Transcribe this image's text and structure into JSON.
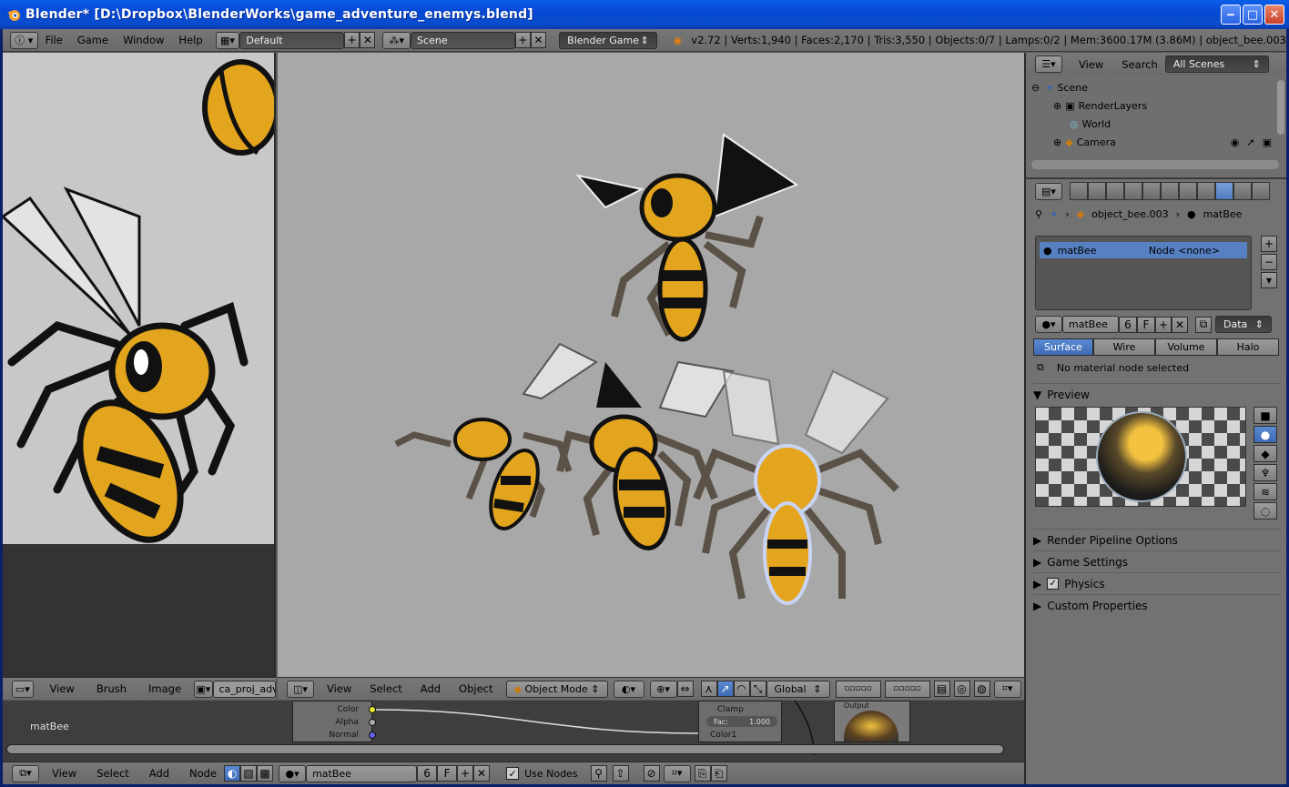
{
  "window": {
    "title": "Blender* [D:\\Dropbox\\BlenderWorks\\game_adventure_enemys.blend]"
  },
  "topbar": {
    "menus": [
      "File",
      "Game",
      "Window",
      "Help"
    ],
    "layout": "Default",
    "scene": "Scene",
    "engine": "Blender Game",
    "stats": "v2.72 | Verts:1,940 | Faces:2,170 | Tris:3,550 | Objects:0/7 | Lamps:0/2 | Mem:3600.17M (3.86M) | object_bee.003"
  },
  "image_editor": {
    "menus": [
      "View",
      "Brush",
      "Image"
    ],
    "image_name": "ca_proj_advent"
  },
  "viewport": {
    "menus": [
      "View",
      "Select",
      "Add",
      "Object"
    ],
    "mode": "Object Mode",
    "orientation": "Global"
  },
  "outliner": {
    "menus": [
      "View",
      "Search"
    ],
    "filter": "All Scenes",
    "items": [
      "Scene",
      "RenderLayers",
      "World",
      "Camera"
    ]
  },
  "properties": {
    "breadcrumb_object": "object_bee.003",
    "breadcrumb_material": "matBee",
    "slot_name": "matBee",
    "slot_node": "Node <none>",
    "material_name": "matBee",
    "users": "6",
    "fake": "F",
    "link": "Data",
    "tabs": [
      "Surface",
      "Wire",
      "Volume",
      "Halo"
    ],
    "no_node": "No material node selected",
    "preview_label": "Preview",
    "sections": [
      "Render Pipeline Options",
      "Game Settings",
      "Physics",
      "Custom Properties"
    ]
  },
  "node_editor": {
    "material_label": "matBee",
    "sockets": [
      "Color",
      "Alpha",
      "Normal"
    ],
    "mix_labels": [
      "Clamp",
      "Fac:",
      "1.000",
      "Color1"
    ],
    "output_label": "Output"
  },
  "bottombar": {
    "menus": [
      "View",
      "Select",
      "Add",
      "Node"
    ],
    "material": "matBee",
    "users": "6",
    "fake": "F",
    "use_nodes": "Use Nodes"
  },
  "colors": {
    "accent": "#5680c2",
    "viewport_bg": "#a8a8a8",
    "bee_yellow": "#e5a91e"
  }
}
